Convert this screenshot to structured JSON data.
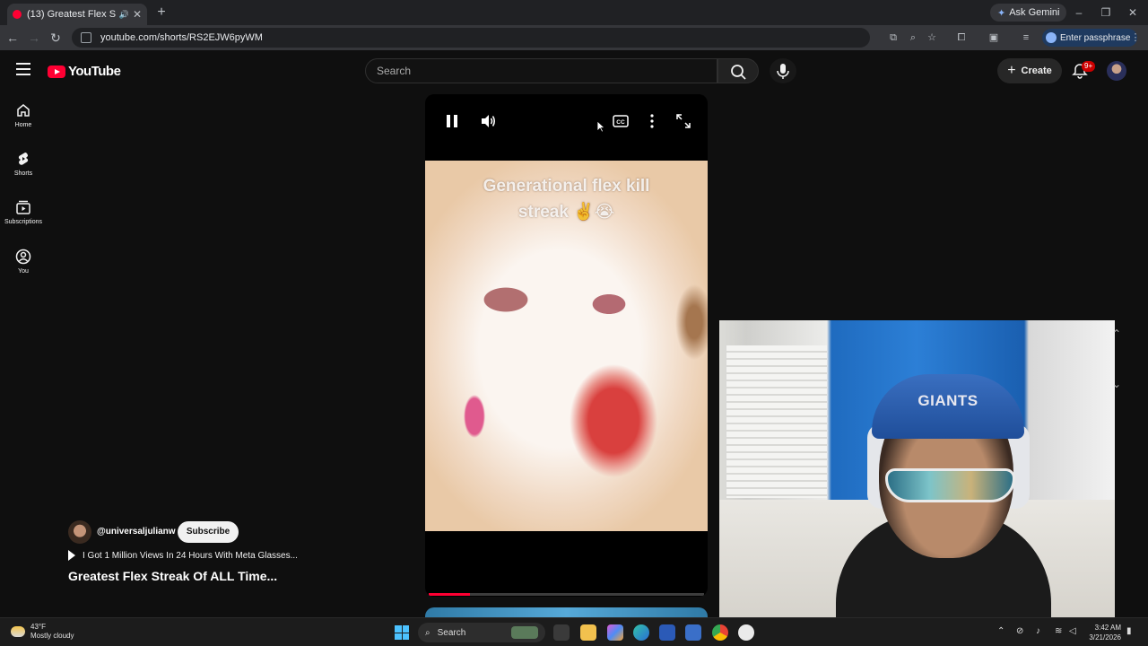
{
  "browser": {
    "tab_title": "(13) Greatest Flex Streak Of ALL Time...",
    "tab_title_visible": "(13) Greatest Flex Streak Of",
    "new_tab_icon": "plus-icon",
    "gemini_label": "Ask Gemini",
    "url": "youtube.com/shorts/RS2EJW6pyWM",
    "passkey_label": "Enter passphrase",
    "window_controls": [
      "minimize-icon",
      "restore-icon",
      "close-icon"
    ]
  },
  "youtube": {
    "logo_text": "YouTube",
    "search_placeholder": "Search",
    "create_label": "Create",
    "notification_count": "9+",
    "nav": [
      {
        "label": "Home",
        "icon": "home-icon"
      },
      {
        "label": "Shorts",
        "icon": "shorts-icon"
      },
      {
        "label": "Subscriptions",
        "icon": "subscriptions-icon"
      },
      {
        "label": "You",
        "icon": "account-icon"
      }
    ]
  },
  "short": {
    "overlay_text_line1": "Generational flex kill",
    "overlay_text_line2": "streak ✌️😭",
    "channel": "@universaljulianw",
    "subscribe_label": "Subscribe",
    "sound_title": "I Got 1 Million Views In 24 Hours With Meta Glasses...",
    "title": "Greatest Flex Streak Of ALL Time...",
    "progress": 0.15,
    "accent_color": "#ff0033"
  },
  "webcam": {
    "cap_text": "GIANTS"
  },
  "taskbar": {
    "temperature": "43°F",
    "weather": "Mostly cloudy",
    "search_label": "Search",
    "time": "3:42 AM",
    "date": "3/21/2026"
  }
}
